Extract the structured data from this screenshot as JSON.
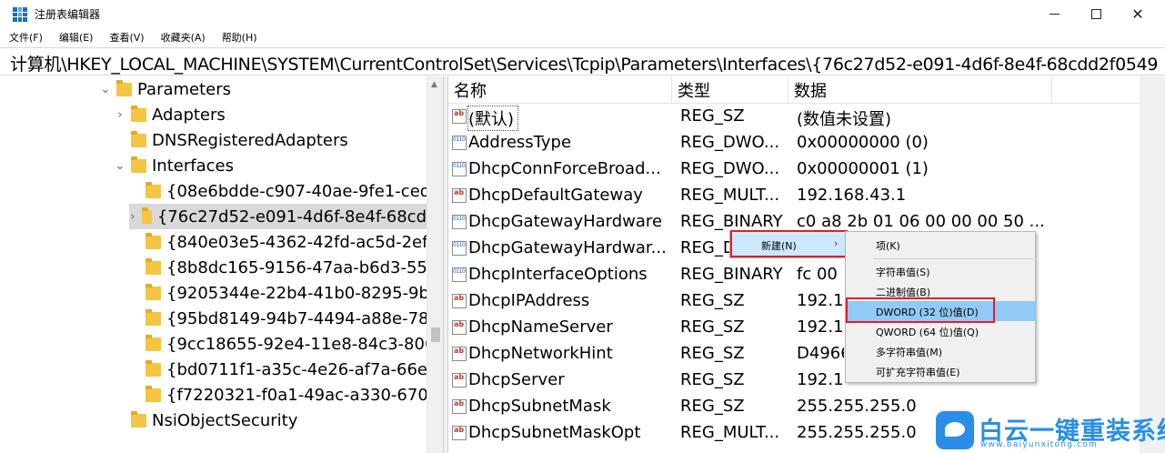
{
  "window": {
    "title": "注册表编辑器",
    "icons": {
      "app": "registry-icon",
      "minimize": "minimize-icon",
      "maximize": "maximize-icon",
      "close": "close-icon"
    }
  },
  "menu": [
    "文件(F)",
    "编辑(E)",
    "查看(V)",
    "收藏夹(A)",
    "帮助(H)"
  ],
  "address": "计算机\\HKEY_LOCAL_MACHINE\\SYSTEM\\CurrentControlSet\\Services\\Tcpip\\Parameters\\Interfaces\\{76c27d52-e091-4d6f-8e4f-68cdd2f0549",
  "tree": [
    {
      "label": "Parameters",
      "chevron": "⌄",
      "level": 0
    },
    {
      "label": "Adapters",
      "chevron": "›",
      "level": 1
    },
    {
      "label": "DNSRegisteredAdapters",
      "chevron": "",
      "level": 1
    },
    {
      "label": "Interfaces",
      "chevron": "⌄",
      "level": 1
    },
    {
      "label": "{08e6bdde-c907-40ae-9fe1-ced",
      "chevron": "",
      "level": 2
    },
    {
      "label": "{76c27d52-e091-4d6f-8e4f-68cd",
      "chevron": "›",
      "level": 2,
      "selected": true
    },
    {
      "label": "{840e03e5-4362-42fd-ac5d-2efc",
      "chevron": "",
      "level": 2
    },
    {
      "label": "{8b8dc165-9156-47aa-b6d3-554",
      "chevron": "",
      "level": 2
    },
    {
      "label": "{9205344e-22b4-41b0-8295-9b1",
      "chevron": "",
      "level": 2
    },
    {
      "label": "{95bd8149-94b7-4494-a88e-788",
      "chevron": "",
      "level": 2
    },
    {
      "label": "{9cc18655-92e4-11e8-84c3-806",
      "chevron": "",
      "level": 2
    },
    {
      "label": "{bd0711f1-a35c-4e26-af7a-66e0",
      "chevron": "",
      "level": 2
    },
    {
      "label": "{f7220321-f0a1-49ac-a330-670a",
      "chevron": "",
      "level": 2
    },
    {
      "label": "NsiObjectSecurity",
      "chevron": "",
      "level": 1
    }
  ],
  "columns": {
    "name": "名称",
    "type": "类型",
    "data": "数据"
  },
  "values": [
    {
      "name": "(默认)",
      "type": "REG_SZ",
      "data": "(数值未设置)",
      "icon": "ab"
    },
    {
      "name": "AddressType",
      "type": "REG_DWO...",
      "data": "0x00000000 (0)",
      "icon": "bin"
    },
    {
      "name": "DhcpConnForceBroad...",
      "type": "REG_DWO...",
      "data": "0x00000001 (1)",
      "icon": "bin"
    },
    {
      "name": "DhcpDefaultGateway",
      "type": "REG_MULT...",
      "data": "192.168.43.1",
      "icon": "ab"
    },
    {
      "name": "DhcpGatewayHardware",
      "type": "REG_BINARY",
      "data": "c0 a8 2b 01 06 00 00 00 50 ...",
      "icon": "bin"
    },
    {
      "name": "DhcpGatewayHardwar...",
      "type": "REG_D",
      "data": "",
      "icon": "bin"
    },
    {
      "name": "DhcpInterfaceOptions",
      "type": "REG_BINARY",
      "data": "fc 00",
      "icon": "bin"
    },
    {
      "name": "DhcpIPAddress",
      "type": "REG_SZ",
      "data": "192.1",
      "icon": "ab"
    },
    {
      "name": "DhcpNameServer",
      "type": "REG_SZ",
      "data": "192.1",
      "icon": "ab"
    },
    {
      "name": "DhcpNetworkHint",
      "type": "REG_SZ",
      "data": "D4966",
      "icon": "ab"
    },
    {
      "name": "DhcpServer",
      "type": "REG_SZ",
      "data": "192.1",
      "icon": "ab"
    },
    {
      "name": "DhcpSubnetMask",
      "type": "REG_SZ",
      "data": "255.255.255.0",
      "icon": "ab"
    },
    {
      "name": "DhcpSubnetMaskOpt",
      "type": "REG_MULT...",
      "data": "255.255.255.0",
      "icon": "ab"
    }
  ],
  "context_menu": {
    "new_label": "新建(N)",
    "submenu": [
      "项(K)",
      "字符串值(S)",
      "二进制值(B)",
      "DWORD (32 位)值(D)",
      "QWORD (64 位)值(Q)",
      "多字符串值(M)",
      "可扩充字符串值(E)"
    ],
    "highlighted": "DWORD (32 位)值(D)"
  },
  "watermark": {
    "title": "白云一键重装系统",
    "url": "www.baiyunxitong.com"
  },
  "colors": {
    "accent": "#2a8ee8",
    "highlight_box": "#e31d2b",
    "menu_hover": "#91c9f7"
  }
}
